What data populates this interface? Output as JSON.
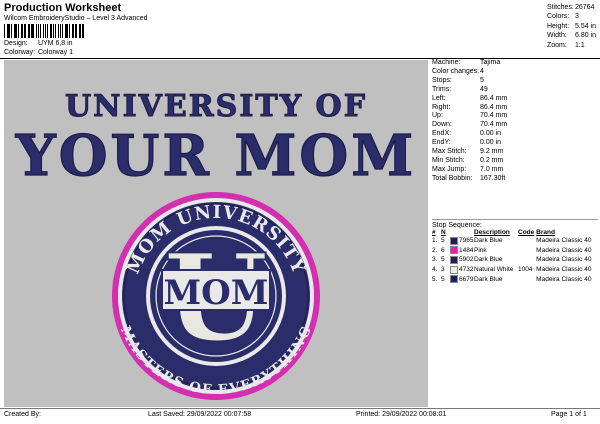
{
  "header": {
    "title": "Production Worksheet",
    "subtitle": "Wilcom EmbroideryStudio – Level 3 Advanced",
    "design_label": "Design:",
    "design_value": "UYM 6,8 in",
    "colorway_label": "Colorway:",
    "colorway_value": "Colorway 1"
  },
  "stats": [
    {
      "label": "Stitches:",
      "value": "26764"
    },
    {
      "label": "Colors:",
      "value": "3"
    },
    {
      "label": "Height:",
      "value": "5.54 in"
    },
    {
      "label": "Width:",
      "value": "6.80 in"
    },
    {
      "label": "Zoom:",
      "value": "1:1"
    }
  ],
  "design": {
    "line1": "UNIVERSITY OF",
    "line2": "YOUR MOM",
    "arc_top": "MOM UNIVERSITY",
    "arc_bottom": "MASTERS OF EVERYTHING",
    "center": "MOM",
    "center_letter": "U"
  },
  "machine_info": [
    {
      "label": "Machine:",
      "value": "Tajima"
    },
    {
      "label": "Color changes:",
      "value": "4"
    },
    {
      "label": "Stops:",
      "value": "5"
    },
    {
      "label": "Trims:",
      "value": "49"
    },
    {
      "label": "Left:",
      "value": "86.4 mm"
    },
    {
      "label": "Right:",
      "value": "86.4 mm"
    },
    {
      "label": "Up:",
      "value": "70.4 mm"
    },
    {
      "label": "Down:",
      "value": "70.4 mm"
    },
    {
      "label": "EndX:",
      "value": "0.00 in"
    },
    {
      "label": "EndY:",
      "value": "0.00 in"
    },
    {
      "label": "Max Stitch:",
      "value": "9.2 mm"
    },
    {
      "label": "Min Stitch:",
      "value": "0.2 mm"
    },
    {
      "label": "Max Jump:",
      "value": "7.0 mm"
    },
    {
      "label": "Total Bobbin:",
      "value": "167.30ft"
    }
  ],
  "stop_sequence": {
    "title": "Stop Sequence:",
    "columns": [
      "#",
      "N",
      "",
      "Description",
      "Code",
      "Brand"
    ],
    "rows": [
      {
        "num": "1.",
        "n": "5",
        "color": "#1c1f5c",
        "code_thread": "7965",
        "desc": "Dark Blue",
        "code": "",
        "brand": "Madeira Classic 40"
      },
      {
        "num": "2.",
        "n": "6",
        "color": "#e020b0",
        "code_thread": "1484",
        "desc": "Pink",
        "code": "",
        "brand": "Madeira Classic 40"
      },
      {
        "num": "3.",
        "n": "5",
        "color": "#1c1f5c",
        "code_thread": "5902",
        "desc": "Dark Blue",
        "code": "",
        "brand": "Madeira Classic 40"
      },
      {
        "num": "4.",
        "n": "3",
        "color": "#eeeee6",
        "code_thread": "4732",
        "desc": "Natural White",
        "code": "1004",
        "brand": "Madeira Classic 40"
      },
      {
        "num": "5.",
        "n": "5",
        "color": "#1c1f5c",
        "code_thread": "6679",
        "desc": "Dark Blue",
        "code": "",
        "brand": "Madeira Classic 40"
      }
    ]
  },
  "footer": {
    "created_by": "Created By:",
    "last_saved": "Last Saved: 29/09/2022 00:07:58",
    "printed": "Printed: 29/09/2022 00:08:01",
    "page": "Page 1 of 1"
  },
  "colors": {
    "navy": "#2b2d6b",
    "pink": "#d42fb0",
    "white_thread": "#eeeee6",
    "background": "#c0c0c0"
  }
}
